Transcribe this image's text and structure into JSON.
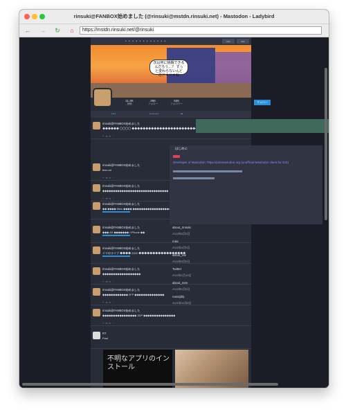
{
  "window": {
    "title": "rinsuki@FANBOX始めました (@rinsuki@mstdn.rinsuki.net) - Mastodon - Ladybird",
    "url": "https://mstdn.rinsuki.net/@rinsuki"
  },
  "colors": {
    "accent": "#2b90d9",
    "page_bg": "#1b1d26",
    "column_bg": "#282c37"
  },
  "profile": {
    "banner_text": "次は何に挑戦できる\nんだろう…？ すっ\nと変わらないんど\nのドキドキね",
    "stats": [
      {
        "value": "11.3K",
        "label": "投稿"
      },
      {
        "value": "286",
        "label": "フォロー"
      },
      {
        "value": "526",
        "label": "フォロワー"
      }
    ],
    "follow_label": "フォロー"
  },
  "posts": [
    {
      "name": "rinsuki@FANBOX始めました",
      "body": "◆◆◆◆◆◆ 〇〇〇〇 ◆◆◆◆◆◆◆◆◆◆◆◆◆◆◆◆◆◆◆◆◆◆◆◆◆"
    },
    {
      "name": "rinsuki@FANBOX始めました",
      "body": "test uni"
    },
    {
      "name": "rinsuki@FANBOX始めました",
      "body": "◆◆◆◆◆◆◆◆◆◆◆◆◆◆◆◆◆◆◆◆◆◆◆◆◆◆◆◆◆◆◆"
    },
    {
      "name": "rinsuki@FANBOX始めました",
      "body": "◆◆ ◆◆◆◆ Mew ◆◆◆◆ ◆◆◆◆◆◆◆◆◆◆◆◆◆◆◆◆◆◆◆◆◆"
    },
    {
      "name": "rinsuki@FANBOX始めました",
      "body": "◆◆◆ AS ◆◆◆◆◆◆◆ / iPhone ◆◆"
    },
    {
      "name": "rinsuki@FANBOX始めました",
      "body": "ミリのライブ ◆◆◆◆ 2022 ◆◆◆◆◆◆◆◆◆◆◆◆◆◆◆◆◆"
    },
    {
      "name": "rinsuki@FANBOX始めました",
      "body": "◆◆◆◆◆◆◆◆◆◆◆◆◆◆◆◆◆◆"
    },
    {
      "name": "rinsuki@FANBOX始めました",
      "body": "◆◆◆◆◆◆◆◆◆◆◆◆ 2FP ◆◆◆◆◆◆◆◆◆◆◆◆◆◆"
    },
    {
      "name": "rinsuki@FANBOX始めました",
      "body": "◆◆◆◆◆◆◆◆◆◆◆◆◆◆◆◆ 2DP ◆◆◆◆◆◆◆◆◆◆◆◆◆◆◆"
    }
  ],
  "last_post": {
    "name": "RT",
    "body": "Post"
  },
  "right_panel": {
    "title": "はじめに",
    "link_text": "Developer of Mastodon: https://joinmastodon.org (unofficial Mastodon client for iOS)",
    "items": [
      {
        "label": "about_rinsuki",
        "sub": "2022年5月3日"
      },
      {
        "label": "misc",
        "sub": "2022年4月9日"
      },
      {
        "label": "about_me",
        "sub": "2022年3月9日"
      },
      {
        "label": "Twitter",
        "sub": "2022年1月19日"
      },
      {
        "label": "about_nsm",
        "sub": "2022年1月9日"
      },
      {
        "label": "noss(db)",
        "sub": "2021年12月8日"
      }
    ]
  },
  "screenshot_caption": "不明なアプリのインストール"
}
